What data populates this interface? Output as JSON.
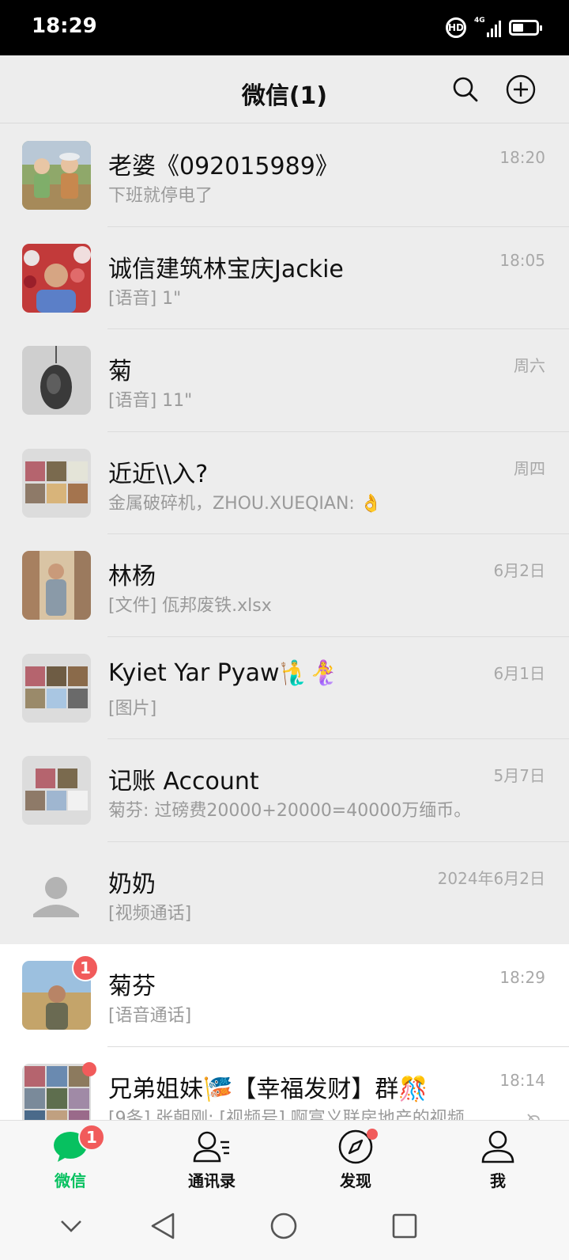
{
  "status_bar": {
    "time": "18:29",
    "hd_label": "HD",
    "network_label": "4G",
    "battery_level": 0.45
  },
  "header": {
    "title": "微信(1)"
  },
  "chats": [
    {
      "name": "老婆《092015989》",
      "preview": "下班就停电了",
      "time": "18:20",
      "avatar": "photo-kids",
      "pinned": true
    },
    {
      "name": "诚信建筑林宝庆Jackie",
      "preview": "[语音] 1\"",
      "time": "18:05",
      "avatar": "photo-man-balloons",
      "pinned": true
    },
    {
      "name": "菊",
      "preview": "[语音] 11\"",
      "time": "周六",
      "avatar": "photo-pendant",
      "pinned": true
    },
    {
      "name": "近近\\\\入?",
      "preview": "金属破碎机，ZHOU.XUEQIAN: 👌",
      "time": "周四",
      "avatar": "group-grid",
      "pinned": true
    },
    {
      "name": "林杨",
      "preview": "[文件] 佤邦废铁.xlsx",
      "time": "6月2日",
      "avatar": "photo-man-building",
      "pinned": true
    },
    {
      "name": "Kyiet Yar Pyaw🧜‍♂️🧜‍♀️",
      "preview": "[图片]",
      "time": "6月1日",
      "avatar": "group-grid",
      "pinned": true
    },
    {
      "name": "记账 Account",
      "preview": "菊芬: 过磅费20000+20000=40000万缅币。",
      "time": "5月7日",
      "avatar": "group-grid",
      "pinned": true
    },
    {
      "name": "奶奶",
      "preview": "[视频通话]",
      "time": "2024年6月2日",
      "avatar": "default-person",
      "pinned": true
    },
    {
      "name": "菊芬",
      "preview": "[语音通话]",
      "time": "18:29",
      "avatar": "photo-woman-field",
      "pinned": false,
      "badge": "1"
    },
    {
      "name": "兄弟姐妹🎏【幸福发财】群🎊",
      "preview": "[9条] 张朝刚: [视频号] 啊富义联房地产的视频",
      "time": "18:14",
      "avatar": "group-grid-9",
      "pinned": false,
      "dot": true,
      "muted": true
    }
  ],
  "tabs": [
    {
      "label": "微信",
      "icon": "chat-bubble-icon",
      "badge": "1",
      "active": true
    },
    {
      "label": "通讯录",
      "icon": "contacts-icon"
    },
    {
      "label": "发现",
      "icon": "compass-icon",
      "dot": true
    },
    {
      "label": "我",
      "icon": "person-icon"
    }
  ],
  "colors": {
    "accent": "#07c160",
    "badge": "#f15b5b",
    "pinned_bg": "#ededed"
  }
}
